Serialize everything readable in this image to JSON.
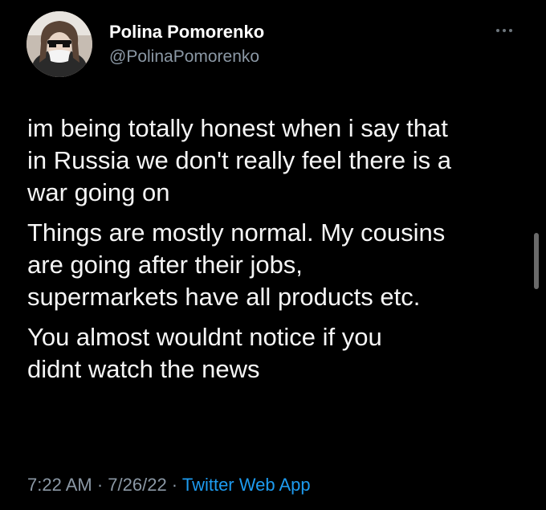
{
  "author": {
    "name": "Polina Pomorenko",
    "handle": "@PolinaPomorenko",
    "avatar_icon": "profile-photo-icon"
  },
  "more_icon": "ellipsis-icon",
  "tweet": {
    "paragraphs": [
      "im being totally honest when i say that\nin Russia we don't really feel there is a\nwar going on",
      "Things are mostly normal. My cousins\nare going after their jobs,\nsupermarkets have all products etc.",
      "You almost wouldnt notice if you\ndidnt watch the news"
    ]
  },
  "meta": {
    "time": "7:22 AM",
    "separator": " · ",
    "date": "7/26/22",
    "source": "Twitter Web App"
  },
  "colors": {
    "background": "#000000",
    "text": "#e7e9ea",
    "secondary": "#8b98a5",
    "link": "#1d9bf0"
  }
}
